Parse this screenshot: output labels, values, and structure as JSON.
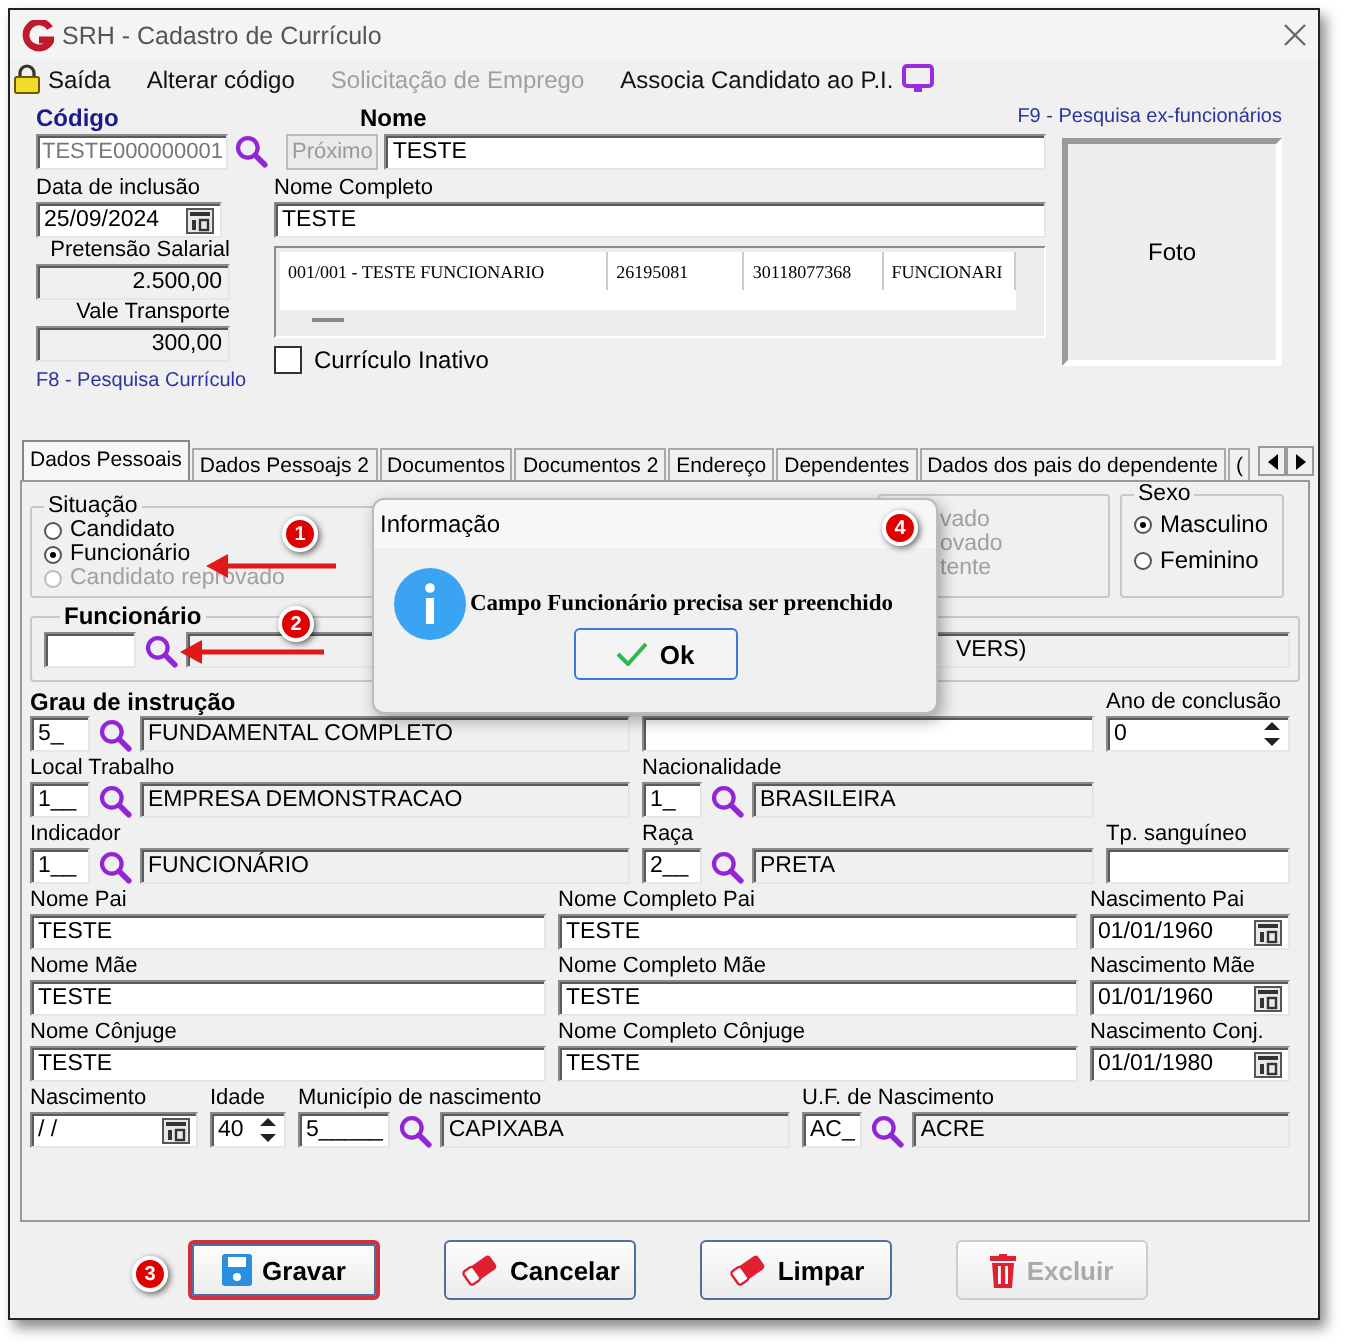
{
  "window": {
    "title": "SRH - Cadastro de Currículo"
  },
  "menu": [
    {
      "label": "Saída",
      "disabled": false
    },
    {
      "label": "Alterar código",
      "disabled": false
    },
    {
      "label": "Solicitação de Emprego",
      "disabled": true
    },
    {
      "label": "Associa Candidato ao P.I.",
      "disabled": false
    }
  ],
  "header": {
    "codigo_label": "Código",
    "codigo": "TESTE000000001",
    "proximo": {
      "label": "Próximo",
      "disabled": true
    },
    "nome_label": "Nome",
    "nome": "TESTE",
    "data_label": "Data de inclusão",
    "data": "25/09/2024",
    "nome_completo_label": "Nome Completo",
    "nome_completo": "TESTE",
    "pretensao_label": "Pretensão Salarial",
    "pretensao": "2.500,00",
    "vale_label": "Vale Transporte",
    "vale": "300,00",
    "f8_link": "F8 - Pesquisa Currículo",
    "f9_link": "F9 - Pesquisa ex-funcionários",
    "foto": "Foto",
    "inativo": {
      "label": "Currículo Inativo",
      "checked": false
    }
  },
  "grid": {
    "rows": [
      [
        "001/001 - TESTE FUNCIONARIO",
        "26195081",
        "30118077368",
        "FUNCIONARI"
      ]
    ]
  },
  "tabs": [
    {
      "label": "Dados Pessoais",
      "selected": true
    },
    {
      "label": "Dados Pessoajs 2",
      "selected": false
    },
    {
      "label": "Documentos",
      "selected": false
    },
    {
      "label": "Documentos 2",
      "selected": false
    },
    {
      "label": "Endereço",
      "selected": false
    },
    {
      "label": "Dependentes",
      "selected": false
    },
    {
      "label": "Dados dos pais do dependente",
      "selected": false
    },
    {
      "label": "(",
      "selected": false
    }
  ],
  "situacao": {
    "label": "Situação",
    "options": [
      {
        "label": "Candidato",
        "selected": false,
        "disabled": false
      },
      {
        "label": "Funcionário",
        "selected": true,
        "disabled": false
      },
      {
        "label": "Candidato reprovado",
        "selected": false,
        "disabled": true
      }
    ]
  },
  "status_group": {
    "options": [
      {
        "label": "vado",
        "disabled": true
      },
      {
        "label": "ovado",
        "disabled": true
      },
      {
        "label": "tente",
        "disabled": true
      }
    ]
  },
  "sexo": {
    "label": "Sexo",
    "options": [
      {
        "label": "Masculino",
        "selected": true
      },
      {
        "label": "Feminino",
        "selected": false
      }
    ]
  },
  "funcionario": {
    "label": "Funcionário",
    "name": "VERS)"
  },
  "form_rows": [
    [
      {
        "kind": "lookup",
        "label": "Grau de instrução",
        "bold": true,
        "code": "5_",
        "description": "FUNDAMENTAL COMPLETO"
      },
      {
        "kind": "text"
      },
      {
        "kind": "spin",
        "label": "Ano de conclusão",
        "bold": false,
        "value": "0"
      }
    ],
    [
      {
        "kind": "lookup",
        "label": "Local Trabalho",
        "bold": false,
        "code": "1__",
        "description": "EMPRESA DEMONSTRACAO"
      },
      {
        "kind": "lookup",
        "label": "Nacionalidade",
        "bold": false,
        "code": "1_",
        "description": "BRASILEIRA"
      }
    ],
    [
      {
        "kind": "lookup",
        "label": "Indicador",
        "bold": false,
        "code": "1__",
        "description": "FUNCIONÁRIO"
      },
      {
        "kind": "lookup",
        "label": "Raça",
        "bold": false,
        "code": "2__",
        "description": "PRETA"
      },
      {
        "kind": "text",
        "label": "Tp. sanguíneo",
        "bold": false
      }
    ],
    [
      {
        "kind": "text",
        "label": "Nome Pai",
        "bold": false,
        "value": "TESTE"
      },
      {
        "kind": "text",
        "label": "Nome Completo Pai",
        "bold": false,
        "value": "TESTE"
      },
      {
        "kind": "date",
        "label": "Nascimento Pai",
        "bold": false,
        "value": "01/01/1960"
      }
    ],
    [
      {
        "kind": "text",
        "label": "Nome Mãe",
        "bold": false,
        "value": "TESTE"
      },
      {
        "kind": "text",
        "label": "Nome Completo Mãe",
        "bold": false,
        "value": "TESTE"
      },
      {
        "kind": "date",
        "label": "Nascimento Mãe",
        "bold": false,
        "value": "01/01/1960"
      }
    ],
    [
      {
        "kind": "text",
        "label": "Nome Cônjuge",
        "bold": false,
        "value": "TESTE"
      },
      {
        "kind": "text",
        "label": "Nome Completo Cônjuge",
        "bold": false,
        "value": "TESTE"
      },
      {
        "kind": "date",
        "label": "Nascimento Conj.",
        "bold": false,
        "value": "01/01/1980"
      }
    ],
    [
      {
        "kind": "date",
        "label": "Nascimento",
        "bold": false,
        "value": "/ /"
      },
      {
        "kind": "spin",
        "label": "Idade",
        "bold": false,
        "value": "40"
      },
      {
        "kind": "lookup",
        "label": "Município de nascimento",
        "bold": false,
        "code": "5_____",
        "description": "CAPIXABA"
      },
      {
        "kind": "lookup",
        "label": "U.F. de Nascimento",
        "bold": false,
        "code": "AC_",
        "description": "ACRE"
      }
    ]
  ],
  "buttons": [
    {
      "kind": "save",
      "label": "Gravar",
      "disabled": false,
      "highlighted": true
    },
    {
      "kind": "cancel",
      "label": "Cancelar",
      "disabled": false,
      "highlighted": false
    },
    {
      "kind": "clear",
      "label": "Limpar",
      "disabled": false,
      "highlighted": false
    },
    {
      "kind": "delete",
      "label": "Excluir",
      "disabled": true,
      "highlighted": false
    }
  ],
  "dialog": {
    "title": "Informação",
    "message": "Campo Funcionário precisa ser preenchido",
    "button": "Ok"
  },
  "annotations": [
    {
      "number": "1"
    },
    {
      "number": "2"
    },
    {
      "number": "3"
    },
    {
      "number": "4"
    }
  ]
}
